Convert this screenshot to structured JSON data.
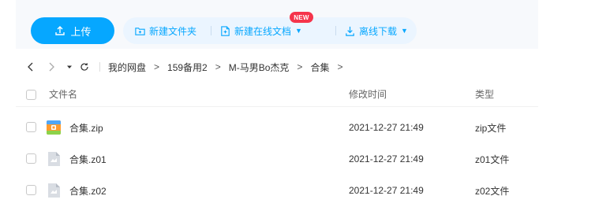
{
  "toolbar": {
    "upload_label": "上传",
    "new_folder_label": "新建文件夹",
    "new_online_doc_label": "新建在线文档",
    "new_badge": "NEW",
    "offline_download_label": "离线下载",
    "caret_glyph": "▼",
    "accent_color": "#06a7ff"
  },
  "breadcrumb": {
    "back_glyph": "‹",
    "forward_glyph": "›",
    "items": [
      "我的网盘",
      "159备用2",
      "M-马男Bo杰克",
      "合集"
    ],
    "separator": ">"
  },
  "table": {
    "headers": {
      "name": "文件名",
      "time": "修改时间",
      "type": "类型"
    },
    "rows": [
      {
        "name": "合集.zip",
        "time": "2021-12-27 21:49",
        "type": "zip文件",
        "icon": "zip-archive-icon"
      },
      {
        "name": "合集.z01",
        "time": "2021-12-27 21:49",
        "type": "z01文件",
        "icon": "generic-file-icon"
      },
      {
        "name": "合集.z02",
        "time": "2021-12-27 21:49",
        "type": "z02文件",
        "icon": "generic-file-icon"
      }
    ]
  }
}
